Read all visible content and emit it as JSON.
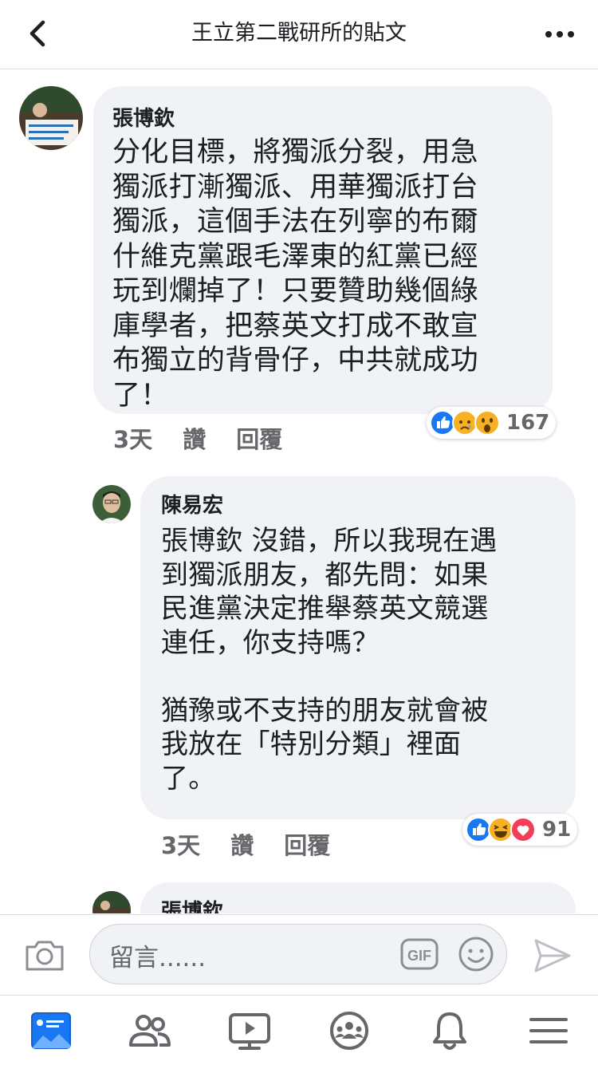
{
  "header": {
    "title": "王立第二戰研所的貼文"
  },
  "comments": [
    {
      "author": "張博欽",
      "text": "分化目標，將獨派分裂，用急\n獨派打漸獨派、用華獨派打台\n獨派，這個手法在列寧的布爾\n什維克黨跟毛澤東的紅黨已經\n玩到爛掉了！只要贊助幾個綠\n庫學者，把蔡英文打成不敢宣\n布獨立的背骨仔，中共就成功\n了！",
      "time": "3天",
      "like_label": "讚",
      "reply_label": "回覆",
      "reaction_icons": [
        "like-icon",
        "sad-icon",
        "wow-icon"
      ],
      "reaction_count": "167"
    },
    {
      "author": "陳易宏",
      "text": "張博欽 沒錯，所以我現在遇\n到獨派朋友，都先問：如果\n民進黨決定推舉蔡英文競選\n連任，你支持嗎？\n\n猶豫或不支持的朋友就會被\n我放在「特別分類」裡面\n了。",
      "time": "3天",
      "like_label": "讚",
      "reply_label": "回覆",
      "reaction_icons": [
        "like-icon",
        "haha-icon",
        "love-icon"
      ],
      "reaction_count": "91"
    },
    {
      "author": "張博欽"
    }
  ],
  "composer": {
    "placeholder": "留言......",
    "gif_label": "GIF"
  },
  "colors": {
    "like": "#1877f2",
    "love": "#f33e58",
    "yellow": "#f7b125",
    "bubble": "#f0f2f5",
    "icon_gray": "#65676b"
  },
  "tabs": [
    "news-feed-icon",
    "friends-icon",
    "watch-icon",
    "groups-icon",
    "notifications-icon",
    "menu-icon"
  ]
}
